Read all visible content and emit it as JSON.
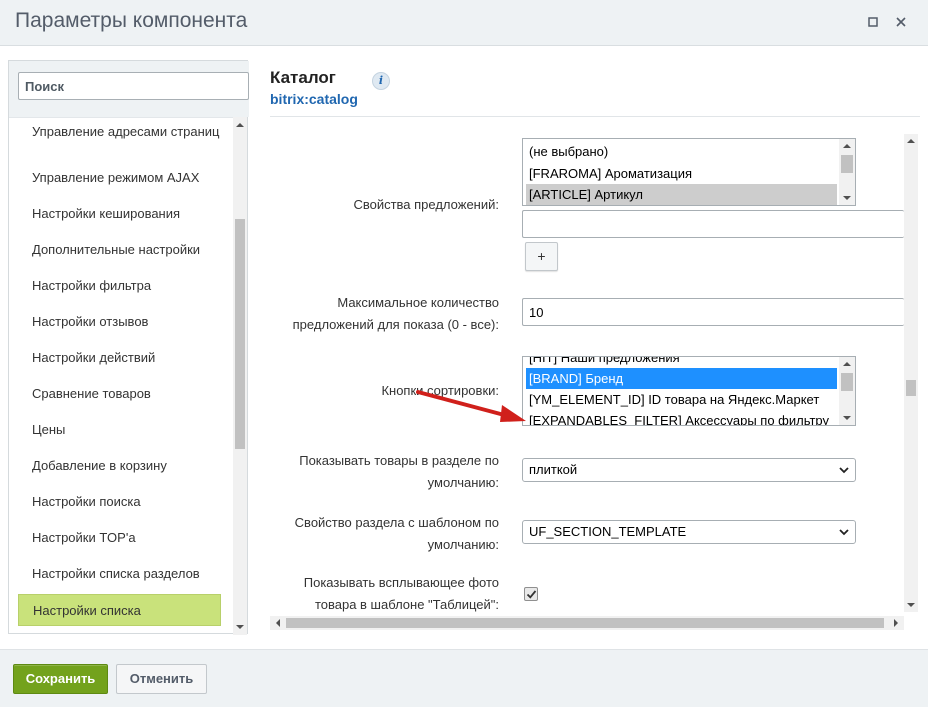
{
  "window": {
    "title": "Параметры компонента"
  },
  "sidebar": {
    "search_placeholder": "Поиск",
    "items": [
      {
        "label": "Управление адресами страниц"
      },
      {
        "label": "Управление режимом AJAX"
      },
      {
        "label": "Настройки кеширования"
      },
      {
        "label": "Дополнительные настройки"
      },
      {
        "label": "Настройки фильтра"
      },
      {
        "label": "Настройки отзывов"
      },
      {
        "label": "Настройки действий"
      },
      {
        "label": "Сравнение товаров"
      },
      {
        "label": "Цены"
      },
      {
        "label": "Добавление в корзину"
      },
      {
        "label": "Настройки поиска"
      },
      {
        "label": "Настройки TOP'а"
      },
      {
        "label": "Настройки списка разделов"
      },
      {
        "label": "Настройки списка",
        "active": true
      }
    ]
  },
  "component": {
    "title": "Каталог",
    "code": "bitrix:catalog",
    "info_icon": "i"
  },
  "properties": {
    "offer_props": {
      "label": "Свойства предложений:",
      "options": [
        "(не выбрано)",
        "[FRAROMA] Ароматизация",
        "[ARTICLE] Артикул"
      ],
      "selected": "[ARTICLE] Артикул",
      "add_input_value": "",
      "add_button": "+"
    },
    "max_offers": {
      "label": "Максимальное количество предложений для показа (0 - все):",
      "value": "10"
    },
    "sort_buttons": {
      "label": "Кнопки сортировки:",
      "options": [
        "[HIT] Наши предложения",
        "[BRAND] Бренд",
        "[YM_ELEMENT_ID] ID товара на Яндекс.Маркет",
        "[EXPANDABLES_FILTER] Аксессуары по фильтру"
      ],
      "selected": "[BRAND] Бренд"
    },
    "section_view": {
      "label": "Показывать товары в разделе по умолчанию:",
      "value": "плиткой"
    },
    "section_template_prop": {
      "label": "Свойство раздела с шаблоном по умолчанию:",
      "value": "UF_SECTION_TEMPLATE"
    },
    "popup_photo": {
      "label": "Показывать всплывающее фото товара в шаблоне \"Таблицей\":",
      "checked": true
    }
  },
  "footer": {
    "save_label": "Сохранить",
    "cancel_label": "Отменить"
  },
  "colors": {
    "save_button": "#73a21c",
    "active_nav": "#c9e27b",
    "selected_option": "#1e90ff",
    "link": "#2067b0",
    "annotation_arrow": "#d0201b"
  }
}
